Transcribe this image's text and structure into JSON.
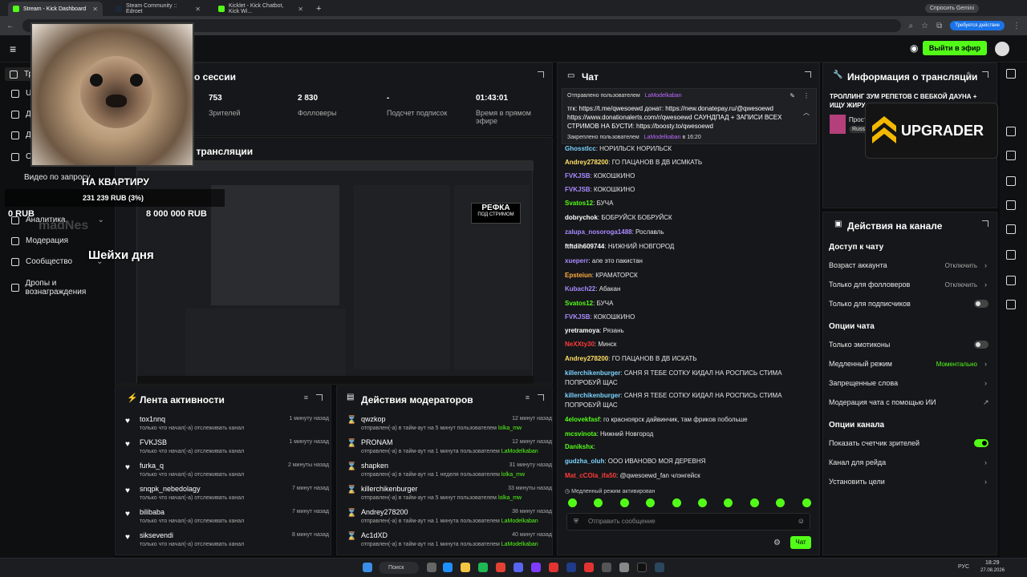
{
  "browser": {
    "tabs": [
      {
        "label": "Stream - Kick Dashboard",
        "active": true
      },
      {
        "label": "Steam Community :: Edroet",
        "active": false
      },
      {
        "label": "Kicklet - Kick Chatbot, Kick Wi...",
        "active": false
      }
    ],
    "gemini_label": "Спросить Gemini",
    "update_label": "Требуется действие"
  },
  "header": {
    "go_live_label": "Выйти в эфир"
  },
  "sidebar": {
    "items": [
      {
        "label": "Тр"
      },
      {
        "label": "U"
      },
      {
        "label": "Д"
      },
      {
        "label": "Д"
      },
      {
        "label": "Ст"
      },
      {
        "label": "Видео по запросу"
      },
      {
        "label": "Аналитика"
      },
      {
        "label": "Модерация"
      },
      {
        "label": "Сообщество"
      },
      {
        "label": "Дропы и вознаграждения"
      }
    ]
  },
  "overlay": {
    "apartment_text": "НА КВАРТИРУ",
    "apartment_amount": "231 239 RUB (3%)",
    "goal_amount": "8 000 000 RUB",
    "left_zero": "0 RUB",
    "shadow_text": "madNes",
    "neck_text": "Шейхи дня",
    "upgrader_label": "UPGRADER",
    "refka_label": "РЕФКА",
    "refka_sub": "ПОД СТРИМОМ"
  },
  "session": {
    "title": "о сессии",
    "stats": [
      {
        "value": "753",
        "label": "Зрителей"
      },
      {
        "value": "2 830",
        "label": "Фолловеры"
      },
      {
        "value": "-",
        "label": "Подсчет подписок"
      },
      {
        "value": "01:43:01",
        "label": "Время в прямом эфире"
      }
    ]
  },
  "preview": {
    "title": "тр трансляции"
  },
  "activity": {
    "title": "Лента активности",
    "items": [
      {
        "name": "tox1nnq",
        "sub": "только что начал(-а) отслеживать канал",
        "time": "1 минуту назад"
      },
      {
        "name": "FVKJSB",
        "sub": "только что начал(-а) отслеживать канал",
        "time": "1 минуту назад"
      },
      {
        "name": "furka_q",
        "sub": "только что начал(-а) отслеживать канал",
        "time": "2 минуты назад"
      },
      {
        "name": "snqpk_nebedolagy",
        "sub": "только что начал(-а) отслеживать канал",
        "time": "7 минут назад"
      },
      {
        "name": "bilibaba",
        "sub": "только что начал(-а) отслеживать канал",
        "time": "7 минут назад"
      },
      {
        "name": "siksevendi",
        "sub": "только что начал(-а) отслеживать канал",
        "time": "8 минут назад"
      }
    ]
  },
  "moderators": {
    "title": "Действия модераторов",
    "items": [
      {
        "name": "qwzkop",
        "sub": "отправлен(-а) в тайм-аут на 5 минут пользователем",
        "by": "lolka_mw",
        "time": "12 минут назад"
      },
      {
        "name": "PRONAM",
        "sub": "отправлен(-а) в тайм-аут на 1 минута пользователем",
        "by": "LaModelkaban",
        "time": "12 минут назад"
      },
      {
        "name": "shapken",
        "sub": "отправлен(-а) в тайм-аут на 1 неделя пользователем",
        "by": "lolka_mw",
        "time": "31 минуту назад"
      },
      {
        "name": "killerchikenburger",
        "sub": "отправлен(-а) в тайм-аут на 5 минут пользователем",
        "by": "lolka_mw",
        "time": "33 минуты назад"
      },
      {
        "name": "Andrey278200",
        "sub": "отправлен(-а) в тайм-аут на 1 минута пользователем",
        "by": "LaModelkaban",
        "time": "38 минут назад"
      },
      {
        "name": "Ac1dXD",
        "sub": "отправлен(-а) в тайм-аут на 1 минута пользователем",
        "by": "LaModelkaban",
        "time": "40 минут назад"
      }
    ]
  },
  "chat": {
    "title": "Чат",
    "pinned_by_prefix": "Отправлено пользователем",
    "pinned_by_user": "LaModelkaban",
    "pinned_text": "тгк: https://t.me/qwesoewd донат: https://new.donatepay.ru/@qwesoewd https://www.donationalerts.com/r/qwesoewd САУНДПАД + ЗАПИСИ ВСЕХ СТРИМОВ НА БУСТИ: https://boosty.to/qwesoewd",
    "pinned_footer_prefix": "Закреплено пользователем",
    "pinned_footer_user": "LaModelkaban",
    "pinned_footer_time": "в 16:20",
    "messages": [
      {
        "user": "Ghosstlcc",
        "color": "#7bd3ff",
        "text": "НОРИЛЬСК НОРИЛЬСК"
      },
      {
        "user": "Andrey278200",
        "color": "#ffe066",
        "text": "ГО ПАЦАНОВ В ДВ ИСМКАТЬ"
      },
      {
        "user": "FVKJSB",
        "color": "#a98bff",
        "text": "КОКОШКИНО"
      },
      {
        "user": "FVKJSB",
        "color": "#a98bff",
        "text": "КОКОШКИНО"
      },
      {
        "user": "Svatos12",
        "color": "#53fc18",
        "text": "БУЧА"
      },
      {
        "user": "dobrychok",
        "color": "#ffffff",
        "text": "БОБРУЙСК БОБРУЙСК"
      },
      {
        "user": "zalupa_nosoroga1488",
        "color": "#a98bff",
        "text": "Рославль"
      },
      {
        "user": "ftftdih609744",
        "color": "#ffffff",
        "text": "НИЖНИЙ НОВГОРОД"
      },
      {
        "user": "xueperr",
        "color": "#a98bff",
        "text": "але это пакистан"
      },
      {
        "user": "Epsteiun",
        "color": "#ffae42",
        "text": "КРАМАТОРСК"
      },
      {
        "user": "Kubach22",
        "color": "#a98bff",
        "text": "Абакан"
      },
      {
        "user": "Svatos12",
        "color": "#53fc18",
        "text": "БУЧА"
      },
      {
        "user": "FVKJSB",
        "color": "#a98bff",
        "text": "КОКОШКИНО"
      },
      {
        "user": "yretramoya",
        "color": "#ffffff",
        "text": "Рязань"
      },
      {
        "user": "NeXXty30",
        "color": "#ff3b3b",
        "text": "Минск"
      },
      {
        "user": "Andrey278200",
        "color": "#ffe066",
        "text": "ГО ПАЦАНОВ В ДВ ИСКАТЬ"
      },
      {
        "user": "killerchikenburger",
        "color": "#7bd3ff",
        "text": "САНЯ Я ТЕБЕ СОТКУ КИДАЛ НА РОСПИСЬ СТИМА ПОПРОБУЙ ЩАС"
      },
      {
        "user": "killerchikenburger",
        "color": "#7bd3ff",
        "text": "САНЯ Я ТЕБЕ СОТКУ КИДАЛ НА РОСПИСЬ СТИМА ПОПРОБУЙ ЩАС"
      },
      {
        "user": "4elovekfasf",
        "color": "#53fc18",
        "text": "го красноярск дайвинчик, там фриков побольше"
      },
      {
        "user": "mcsvinota",
        "color": "#53fc18",
        "text": "Нижний Новгород"
      },
      {
        "user": "Danikshx",
        "color": "#53fc18",
        "text": ""
      },
      {
        "user": "gudzha_oluh",
        "color": "#7bd3ff",
        "text": "ООО ИВАНОВО МОЯ ДЕРЕВНЯ"
      },
      {
        "user": "Mat_cCOla_ifa50",
        "color": "#ff3b3b",
        "text": "@qwesoewd_fan члэнгейск"
      }
    ],
    "slow_mode_notice": "Медленный режим активирован",
    "input_placeholder": "Отправить сообщение",
    "send_label": "Чат"
  },
  "stream_info": {
    "title": "Информация о трансляции",
    "stream_title": "ТРОЛЛИНГ ЗУМ РЕПЕТОВ С ВЕБКОЙ ДАУНА + ИЩУ ЖИРУ",
    "category_short": "Прост",
    "lang_short": "Russ"
  },
  "channel_actions": {
    "title": "Действия на канале",
    "sections": [
      {
        "heading": "Доступ к чату",
        "rows": [
          {
            "label": "Возраст аккаунта",
            "value": "Отключить",
            "kind": "select"
          },
          {
            "label": "Только для фолловеров",
            "value": "Отключить",
            "kind": "select"
          },
          {
            "label": "Только для подписчиков",
            "value": "",
            "kind": "toggle-off"
          }
        ]
      },
      {
        "heading": "Опции чата",
        "rows": [
          {
            "label": "Только эмотиконы",
            "value": "",
            "kind": "toggle-off"
          },
          {
            "label": "Медленный режим",
            "value": "Моментально",
            "kind": "select-green"
          },
          {
            "label": "Запрещенные слова",
            "value": "",
            "kind": "link"
          },
          {
            "label": "Модерация чата с помощью ИИ",
            "value": "",
            "kind": "external"
          }
        ]
      },
      {
        "heading": "Опции канала",
        "rows": [
          {
            "label": "Показать счетчик зрителей",
            "value": "",
            "kind": "toggle-on"
          },
          {
            "label": "Канал для рейда",
            "value": "",
            "kind": "link"
          },
          {
            "label": "Установить цели",
            "value": "",
            "kind": "link"
          }
        ]
      }
    ]
  },
  "taskbar": {
    "search_label": "Поиск",
    "lang": "РУС",
    "time": "18:29",
    "date": "27.08.2026"
  }
}
